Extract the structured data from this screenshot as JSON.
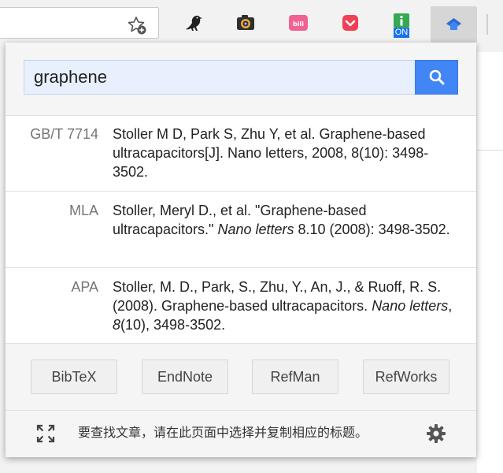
{
  "search": {
    "value": "graphene"
  },
  "citations": [
    {
      "label": "GB/T 7714",
      "text": "Stoller M D, Park S, Zhu Y, et al. Graphene-based ultracapacitors[J]. Nano letters, 2008, 8(10): 3498-3502."
    },
    {
      "label": "MLA",
      "text_before": "Stoller, Meryl D., et al. \"Graphene-based ultracapacitors.\" ",
      "journal": "Nano letters",
      "text_after": " 8.10 (2008): 3498-3502."
    },
    {
      "label": "APA",
      "text_before": "Stoller, M. D., Park, S., Zhu, Y., An, J., & Ruoff, R. S. (2008). Graphene-based ultracapacitors. ",
      "journal": "Nano letters",
      "sep": ", ",
      "volume": "8",
      "text_after": "(10), 3498-3502."
    }
  ],
  "export_buttons": [
    "BibTeX",
    "EndNote",
    "RefMan",
    "RefWorks"
  ],
  "footer": {
    "hint": "要查找文章，请在此页面中选择并复制相应的标题。"
  },
  "toolbar": {
    "extensions": [
      "crow-icon",
      "camera-icon",
      "bilibili-icon",
      "pocket-icon",
      "info-on-icon",
      "scholar-icon"
    ],
    "badge": "ON"
  },
  "colors": {
    "accent": "#4285f4",
    "input_bg": "#e8f0fe",
    "pocket": "#ef4056",
    "bilibili": "#f06292",
    "info": "#34a853"
  }
}
